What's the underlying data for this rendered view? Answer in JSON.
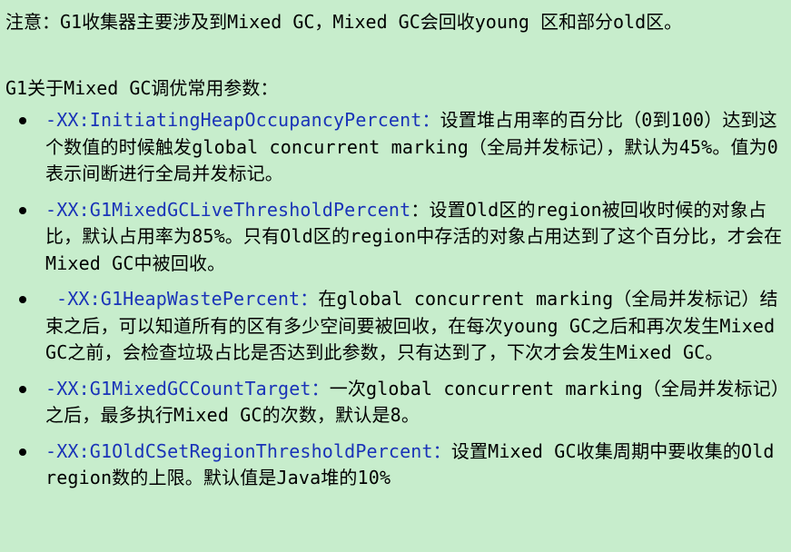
{
  "note": {
    "text": "注意：G1收集器主要涉及到Mixed GC，Mixed GC会回收young 区和部分old区。"
  },
  "heading": {
    "text": "G1关于Mixed GC调优常用参数："
  },
  "params": [
    {
      "name": "-XX:InitiatingHeapOccupancyPercent：",
      "desc": "设置堆占用率的百分比（0到100）达到这个数值的时候触发global concurrent marking（全局并发标记），默认为45%。值为0表示间断进行全局并发标记。"
    },
    {
      "name": "-XX:G1MixedGCLiveThresholdPercent",
      "desc": "：设置Old区的region被回收时候的对象占比，默认占用率为85%。只有Old区的region中存活的对象占用达到了这个百分比，才会在Mixed GC中被回收。"
    },
    {
      "name": "-XX:G1HeapWastePercent：",
      "desc": "在global concurrent marking（全局并发标记）结束之后，可以知道所有的区有多少空间要被回收，在每次young GC之后和再次发生Mixed GC之前，会检查垃圾占比是否达到此参数，只有达到了，下次才会发生Mixed GC。"
    },
    {
      "name": "-XX:G1MixedGCCountTarget：",
      "desc": "一次global concurrent marking（全局并发标记）之后，最多执行Mixed GC的次数，默认是8。"
    },
    {
      "name": "-XX:G1OldCSetRegionThresholdPercent：",
      "desc": "设置Mixed GC收集周期中要收集的Old region数的上限。默认值是Java堆的10%"
    }
  ]
}
